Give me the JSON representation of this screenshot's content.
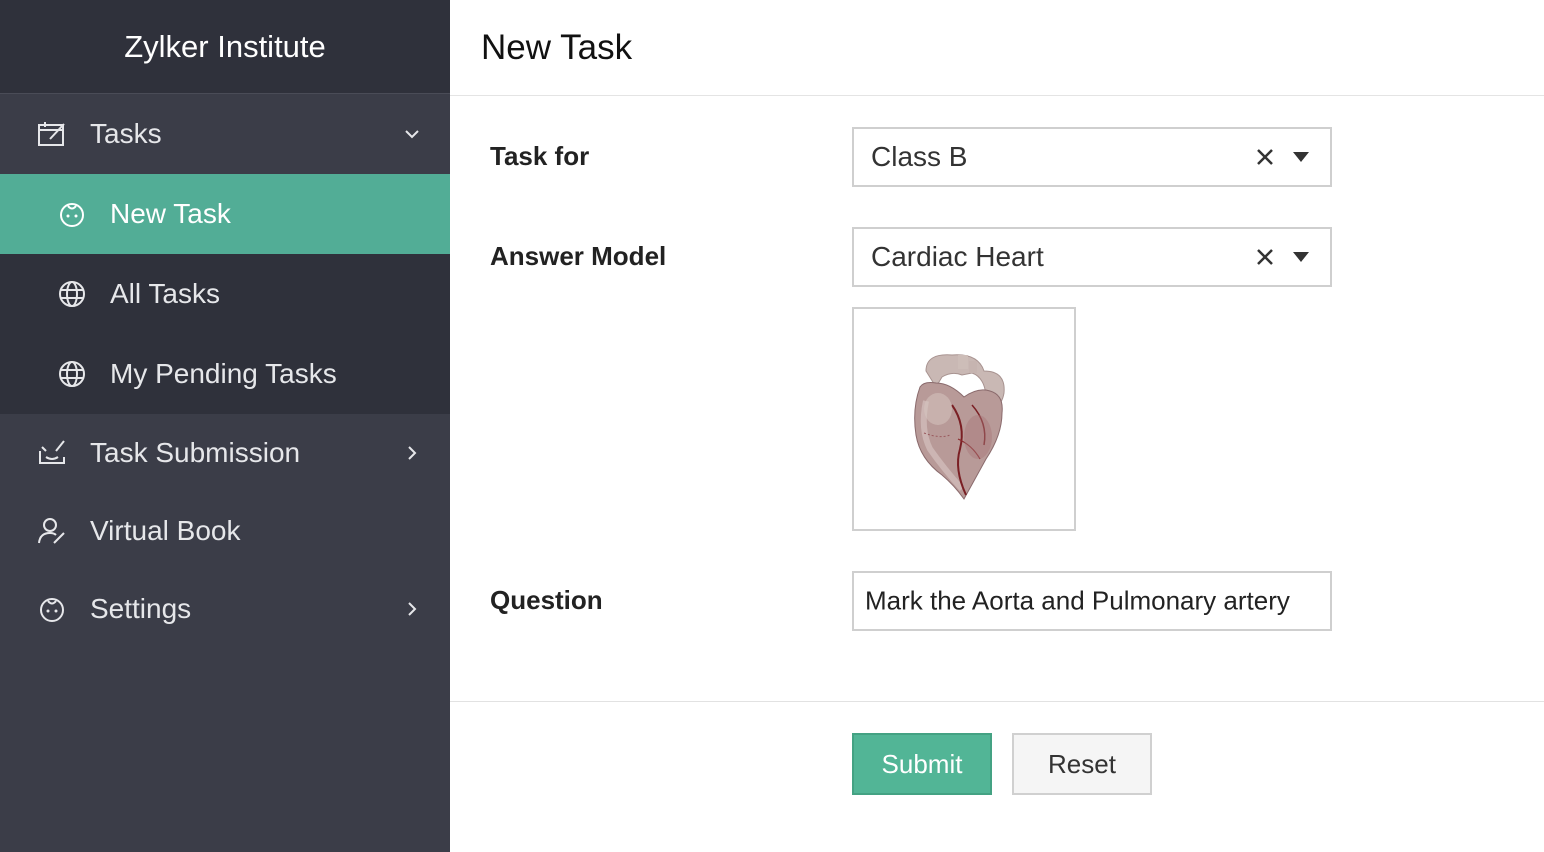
{
  "sidebar": {
    "brand": "Zylker Institute",
    "tasks_label": "Tasks",
    "submenu": [
      {
        "label": "New Task",
        "icon": "face-icon",
        "active": true
      },
      {
        "label": "All Tasks",
        "icon": "globe-icon",
        "active": false
      },
      {
        "label": "My Pending Tasks",
        "icon": "globe-icon",
        "active": false
      }
    ],
    "items": [
      {
        "label": "Task Submission",
        "icon": "submission-icon"
      },
      {
        "label": "Virtual Book",
        "icon": "user-edit-icon"
      },
      {
        "label": "Settings",
        "icon": "face-icon"
      }
    ]
  },
  "main": {
    "title": "New Task",
    "form": {
      "task_for_label": "Task for",
      "task_for_value": "Class B",
      "answer_model_label": "Answer Model",
      "answer_model_value": "Cardiac Heart",
      "question_label": "Question",
      "question_value": "Mark the Aorta and Pulmonary artery"
    },
    "buttons": {
      "submit": "Submit",
      "reset": "Reset"
    }
  },
  "colors": {
    "sidebar_bg": "#3b3d48",
    "sidebar_dark": "#2f313b",
    "accent": "#52ad96",
    "submit": "#52b596"
  }
}
